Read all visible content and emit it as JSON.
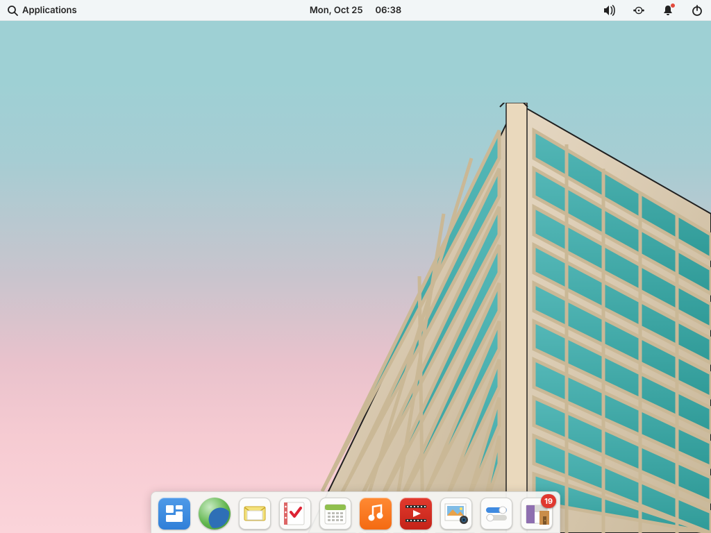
{
  "panel": {
    "applications_label": "Applications",
    "date_label": "Mon, Oct 25",
    "time_label": "06:38"
  },
  "system_tray": {
    "items": [
      "volume",
      "network",
      "notifications",
      "power"
    ],
    "notification_badge": true
  },
  "dock": {
    "items": [
      {
        "name": "workspaces",
        "label": "Multitasking View",
        "badge": null
      },
      {
        "name": "web",
        "label": "Web Browser",
        "badge": null
      },
      {
        "name": "mail",
        "label": "Mail",
        "badge": null
      },
      {
        "name": "tasks",
        "label": "Tasks",
        "badge": null
      },
      {
        "name": "calendar",
        "label": "Calendar",
        "badge": null
      },
      {
        "name": "music",
        "label": "Music",
        "badge": null
      },
      {
        "name": "videos",
        "label": "Videos",
        "badge": null
      },
      {
        "name": "photos",
        "label": "Photos",
        "badge": null
      },
      {
        "name": "settings",
        "label": "System Settings",
        "badge": null
      },
      {
        "name": "appcenter",
        "label": "AppCenter",
        "badge": "19"
      }
    ]
  }
}
